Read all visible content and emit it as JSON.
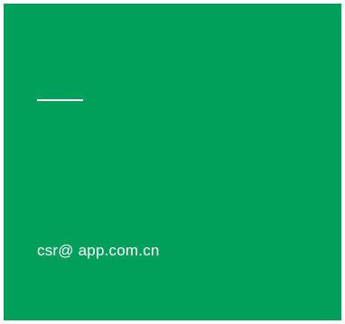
{
  "contact": {
    "email": "csr@ app.com.cn"
  },
  "colors": {
    "panel_background": "#00a05a",
    "foreground": "#ffffff",
    "frame_border": "#ffffff"
  }
}
